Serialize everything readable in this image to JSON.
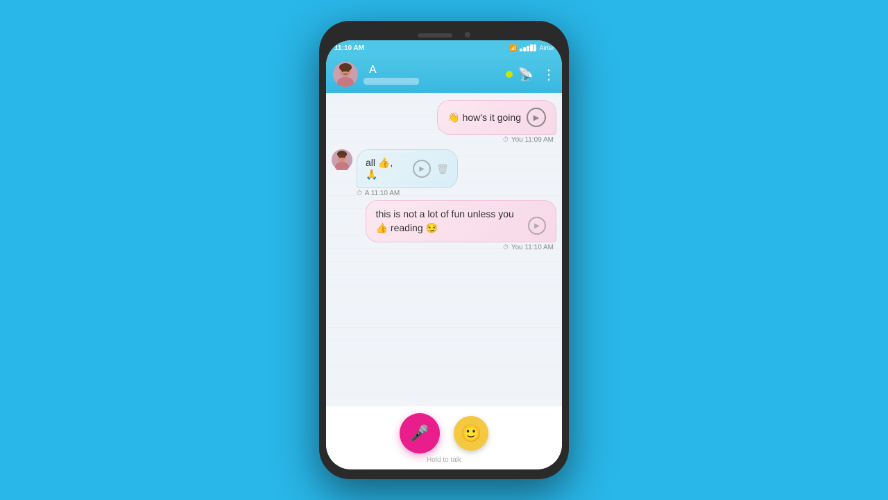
{
  "status_bar": {
    "time": "11:10 AM",
    "carrier": "Airtel"
  },
  "header": {
    "contact_initial": "👩",
    "contact_name": "A",
    "online_indicator": "online"
  },
  "messages": [
    {
      "id": "msg1",
      "type": "outgoing",
      "text": "👋 how's it going",
      "timestamp": "You  11:09 AM",
      "has_play": true
    },
    {
      "id": "msg2",
      "type": "incoming",
      "text": "all 👍, 🙏",
      "sender": "A",
      "timestamp": "A      11:10 AM",
      "has_play": true,
      "has_delete": true
    },
    {
      "id": "msg3",
      "type": "outgoing",
      "text": "this is not a lot of fun unless you 👍 reading 😏",
      "timestamp": "You  11:10 AM",
      "has_play": true
    }
  ],
  "bottom": {
    "hold_to_talk": "Hold to talk",
    "mic_icon": "🎤",
    "emoji_icon": "🙂"
  }
}
